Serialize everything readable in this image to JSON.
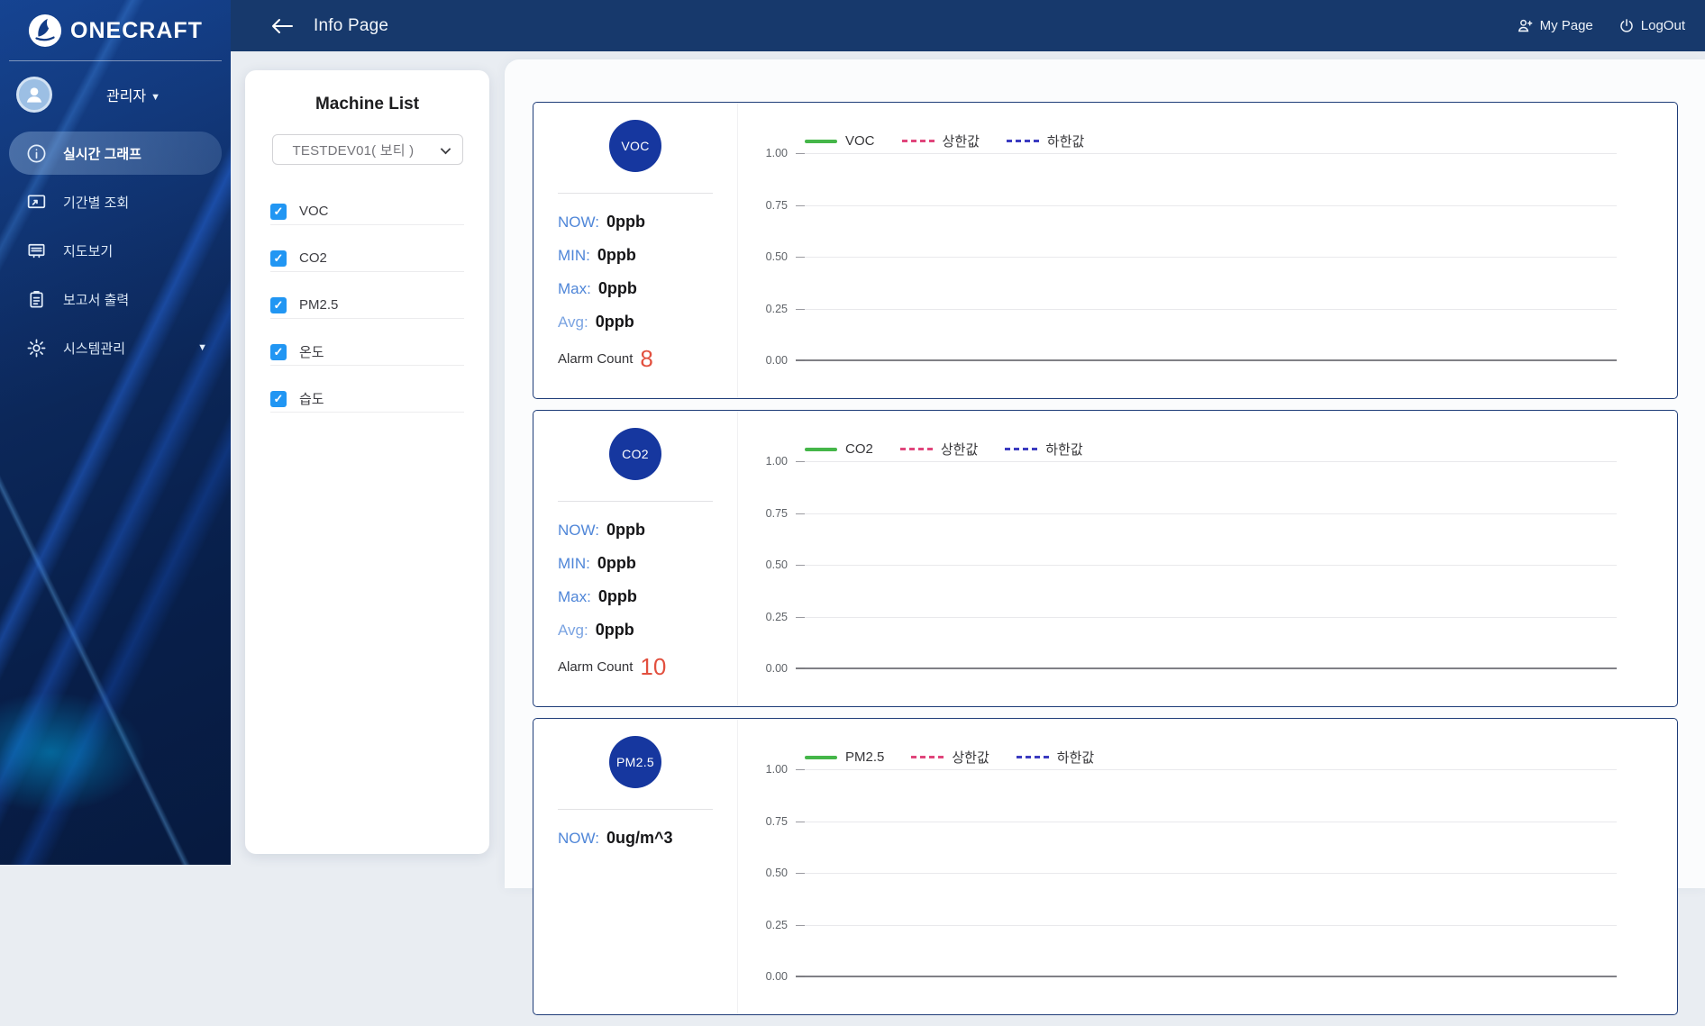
{
  "brand": {
    "name": "ONECRAFT"
  },
  "topbar": {
    "title": "Info Page",
    "my_page_label": "My Page",
    "logout_label": "LogOut"
  },
  "sidebar": {
    "role_label": "관리자",
    "nav": [
      {
        "label": "실시간 그래프",
        "icon": "info-circle-icon",
        "active": true
      },
      {
        "label": "기간별 조회",
        "icon": "screen-share-icon",
        "active": false
      },
      {
        "label": "지도보기",
        "icon": "map-board-icon",
        "active": false
      },
      {
        "label": "보고서 출력",
        "icon": "report-clipboard-icon",
        "active": false
      },
      {
        "label": "시스템관리",
        "icon": "gear-icon",
        "active": false,
        "has_submenu": true
      }
    ]
  },
  "machine_list": {
    "title": "Machine List",
    "device_select": {
      "value": "TESTDEV01( 보티 )"
    },
    "items": [
      {
        "label": "VOC",
        "checked": true
      },
      {
        "label": "CO2",
        "checked": true
      },
      {
        "label": "PM2.5",
        "checked": true
      },
      {
        "label": "온도",
        "checked": true
      },
      {
        "label": "습도",
        "checked": true
      }
    ]
  },
  "cards": [
    {
      "badge": "VOC",
      "stats": [
        {
          "label": "NOW:",
          "value": "0ppb"
        },
        {
          "label": "MIN:",
          "value": "0ppb"
        },
        {
          "label": "Max:",
          "value": "0ppb"
        },
        {
          "label": "Avg:",
          "value": "0ppb"
        }
      ],
      "alarm_label": "Alarm Count",
      "alarm_count": "8"
    },
    {
      "badge": "CO2",
      "stats": [
        {
          "label": "NOW:",
          "value": "0ppb"
        },
        {
          "label": "MIN:",
          "value": "0ppb"
        },
        {
          "label": "Max:",
          "value": "0ppb"
        },
        {
          "label": "Avg:",
          "value": "0ppb"
        }
      ],
      "alarm_label": "Alarm Count",
      "alarm_count": "10"
    },
    {
      "badge": "PM2.5",
      "stats": [
        {
          "label": "NOW:",
          "value": "0ug/m^3"
        }
      ]
    }
  ],
  "chart_data": [
    {
      "type": "line",
      "title": "",
      "legend_position": "top-left",
      "grid": true,
      "ylim": [
        0,
        1
      ],
      "y_ticks": [
        "1.00",
        "0.75",
        "0.50",
        "0.25",
        "0.00"
      ],
      "x_ticks": [],
      "series": [
        {
          "name": "VOC",
          "color": "#45b649",
          "line_style": "solid",
          "values": []
        },
        {
          "name": "상한값",
          "color": "#e0457b",
          "line_style": "dashed",
          "values": []
        },
        {
          "name": "하한값",
          "color": "#3b3bc0",
          "line_style": "dashed",
          "values": []
        }
      ]
    },
    {
      "type": "line",
      "title": "",
      "legend_position": "top-left",
      "grid": true,
      "ylim": [
        0,
        1
      ],
      "y_ticks": [
        "1.00",
        "0.75",
        "0.50",
        "0.25",
        "0.00"
      ],
      "x_ticks": [],
      "series": [
        {
          "name": "CO2",
          "color": "#45b649",
          "line_style": "solid",
          "values": []
        },
        {
          "name": "상한값",
          "color": "#e0457b",
          "line_style": "dashed",
          "values": []
        },
        {
          "name": "하한값",
          "color": "#3b3bc0",
          "line_style": "dashed",
          "values": []
        }
      ]
    },
    {
      "type": "line",
      "title": "",
      "legend_position": "top-left",
      "grid": true,
      "ylim": [
        0,
        1
      ],
      "y_ticks": [
        "1.00",
        "0.75",
        "0.50",
        "0.25",
        "0.00"
      ],
      "x_ticks": [],
      "series": [
        {
          "name": "PM2.5",
          "color": "#45b649",
          "line_style": "solid",
          "values": []
        },
        {
          "name": "상한값",
          "color": "#e0457b",
          "line_style": "dashed",
          "values": []
        },
        {
          "name": "하한값",
          "color": "#3b3bc0",
          "line_style": "dashed",
          "values": []
        }
      ]
    }
  ],
  "colors": {
    "topbar_bg": "#17396c",
    "sidebar_bg": "#081f4a",
    "badge_blue": "#16379f",
    "checkbox_blue": "#2196f3",
    "stat_label_blue": "#4f86d8",
    "alarm_red": "#e2503f",
    "card_border": "#1e3c78",
    "legend_green": "#45b649",
    "legend_pink": "#e0457b",
    "legend_blue": "#3b3bc0"
  }
}
